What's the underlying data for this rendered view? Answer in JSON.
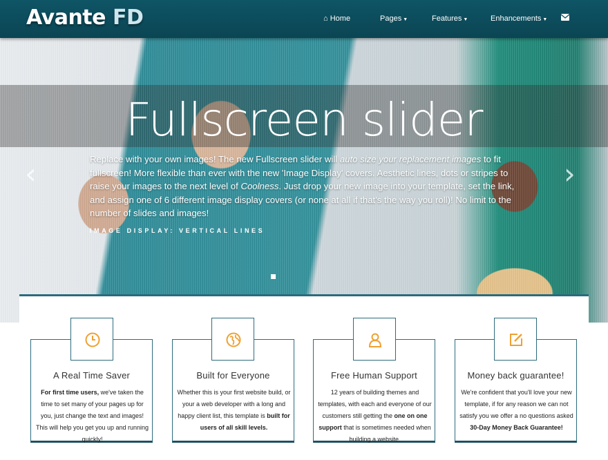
{
  "nav": {
    "brand": "Avante",
    "brand_accent": "FD",
    "items": [
      {
        "label": "Home",
        "icon": "home-icon"
      },
      {
        "label": "Pages"
      },
      {
        "label": "Features"
      },
      {
        "label": "Enhancements"
      },
      {
        "icon": "envelope-icon"
      }
    ]
  },
  "slider": {
    "title": "Fullscreen slider",
    "text_1": "Replace with your own images! The new Fullscreen slider will ",
    "text_italic_1": "auto size your replacement images",
    "text_2": " to fit fullscreen! More flexible than ever with the new 'Image Display' covers. Aesthetic lines, dots or stripes to raise your images to the next level of ",
    "text_italic_2": "Coolness",
    "text_3": ". Just drop your new image into your template, set the link, and assign one of 6 different image display covers (or none at all if that's the way you roll)!  No limit to the number of slides and images!",
    "subtitle": "IMAGE DISPLAY: VERTICAL LINES",
    "prev_arrow": "‹",
    "next_arrow": "›"
  },
  "colors": {
    "nav": "#0e5566",
    "accent": "#f0a030",
    "border": "#2b6b7d"
  },
  "cards": [
    {
      "title": "A Real Time Saver",
      "icon": "clock-icon",
      "b1": "For first time users,",
      "t1": " we've taken the time to set many of your pages up for you, just change the text and images! This will help you get you up and running quickly!",
      "b2": "",
      "t2": ""
    },
    {
      "title": "Built for Everyone",
      "icon": "globe-icon",
      "b1": "",
      "t1": "Whether this is your first website build, or your a web developer with a long and happy client list, this template is ",
      "b2": "built for users of all skill levels.",
      "t2": ""
    },
    {
      "title": "Free Human Support",
      "icon": "user-icon",
      "b1": "",
      "t1": "12 years of building themes and templates, with each and everyone of our customers still getting the ",
      "b2": "one on one support",
      "t2": " that is sometimes needed when building a website."
    },
    {
      "title": "Money back guarantee!",
      "icon": "edit-icon",
      "b1": "",
      "t1": "We're confident that you'll love your new template, if for any reason we can not satisfy you we offer a no questions asked ",
      "b2": "30-Day Money Back Guarantee!",
      "t2": ""
    }
  ]
}
